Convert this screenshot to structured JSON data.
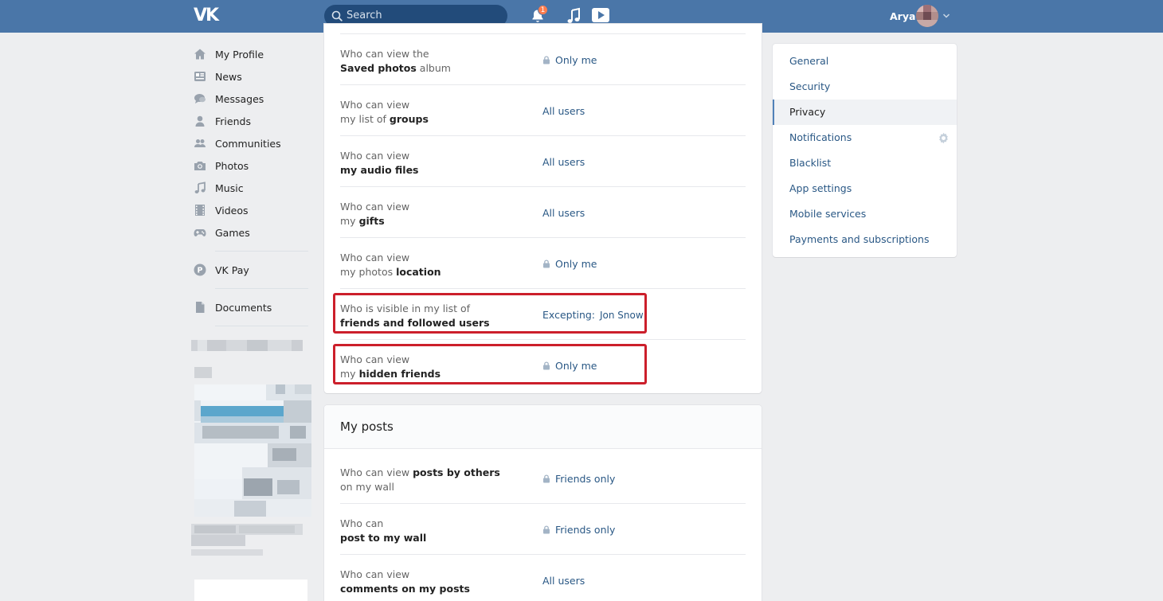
{
  "header": {
    "logo": "VK",
    "search_placeholder": "Search",
    "notification_count": "1",
    "user_name": "Arya"
  },
  "leftnav": {
    "items": [
      {
        "label": "My Profile",
        "icon": "home-icon"
      },
      {
        "label": "News",
        "icon": "news-icon"
      },
      {
        "label": "Messages",
        "icon": "messages-icon"
      },
      {
        "label": "Friends",
        "icon": "friend-icon"
      },
      {
        "label": "Communities",
        "icon": "communities-icon"
      },
      {
        "label": "Photos",
        "icon": "camera-icon"
      },
      {
        "label": "Music",
        "icon": "music-note-icon"
      },
      {
        "label": "Videos",
        "icon": "film-icon"
      },
      {
        "label": "Games",
        "icon": "gamepad-icon"
      },
      {
        "label": "VK Pay",
        "icon": "vkpay-icon"
      },
      {
        "label": "Documents",
        "icon": "document-icon"
      }
    ]
  },
  "privacy": {
    "rows": [
      {
        "q_pre": "Who can view the",
        "q_bold": "Saved photos",
        "q_post": " album",
        "value": "Only me",
        "locked": true
      },
      {
        "q_pre": "Who can view",
        "q_line2_pre": "my list of ",
        "q_bold": "groups",
        "value": "All users",
        "locked": false
      },
      {
        "q_pre": "Who can view",
        "q_bold": "my audio files",
        "value": "All users",
        "locked": false
      },
      {
        "q_pre": "Who can view",
        "q_line2_pre": "my ",
        "q_bold": "gifts",
        "value": "All users",
        "locked": false
      },
      {
        "q_pre": "Who can view",
        "q_line2_pre": "my photos ",
        "q_bold": "location",
        "value": "Only me",
        "locked": true
      },
      {
        "q_pre": "Who is visible in my list of",
        "q_bold": "friends and followed users",
        "value": "Excepting:",
        "value_name": "Jon Snow",
        "locked": false
      },
      {
        "q_pre": "Who can view",
        "q_line2_pre": "my ",
        "q_bold": "hidden friends",
        "value": "Only me",
        "locked": true
      }
    ]
  },
  "posts": {
    "title": "My posts",
    "rows": [
      {
        "q_pre": "Who can view ",
        "q_bold": "posts by others",
        "q_line2": "on my wall",
        "value": "Friends only",
        "locked": true
      },
      {
        "q_pre": "Who can",
        "q_bold": "post to my wall",
        "value": "Friends only",
        "locked": true
      },
      {
        "q_pre": "Who can view",
        "q_bold": "comments on my posts",
        "value": "All users",
        "locked": false
      }
    ]
  },
  "rightmenu": {
    "items": [
      "General",
      "Security",
      "Privacy",
      "Notifications",
      "Blacklist",
      "App settings",
      "Mobile services",
      "Payments and subscriptions"
    ],
    "active": "Privacy"
  },
  "colors": {
    "topbar": "#4a76a8",
    "link": "#2a5885",
    "highlight": "#cc1f2b",
    "badge": "#ff7d4e"
  }
}
